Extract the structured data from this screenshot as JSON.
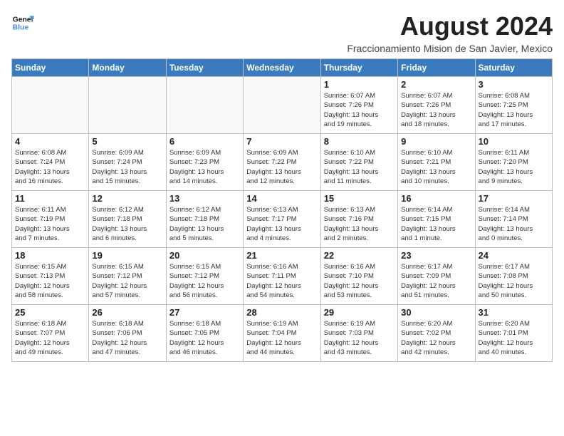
{
  "header": {
    "logo_line1": "General",
    "logo_line2": "Blue",
    "month_year": "August 2024",
    "location": "Fraccionamiento Mision de San Javier, Mexico"
  },
  "days_of_week": [
    "Sunday",
    "Monday",
    "Tuesday",
    "Wednesday",
    "Thursday",
    "Friday",
    "Saturday"
  ],
  "weeks": [
    [
      {
        "day": "",
        "info": ""
      },
      {
        "day": "",
        "info": ""
      },
      {
        "day": "",
        "info": ""
      },
      {
        "day": "",
        "info": ""
      },
      {
        "day": "1",
        "info": "Sunrise: 6:07 AM\nSunset: 7:26 PM\nDaylight: 13 hours\nand 19 minutes."
      },
      {
        "day": "2",
        "info": "Sunrise: 6:07 AM\nSunset: 7:26 PM\nDaylight: 13 hours\nand 18 minutes."
      },
      {
        "day": "3",
        "info": "Sunrise: 6:08 AM\nSunset: 7:25 PM\nDaylight: 13 hours\nand 17 minutes."
      }
    ],
    [
      {
        "day": "4",
        "info": "Sunrise: 6:08 AM\nSunset: 7:24 PM\nDaylight: 13 hours\nand 16 minutes."
      },
      {
        "day": "5",
        "info": "Sunrise: 6:09 AM\nSunset: 7:24 PM\nDaylight: 13 hours\nand 15 minutes."
      },
      {
        "day": "6",
        "info": "Sunrise: 6:09 AM\nSunset: 7:23 PM\nDaylight: 13 hours\nand 14 minutes."
      },
      {
        "day": "7",
        "info": "Sunrise: 6:09 AM\nSunset: 7:22 PM\nDaylight: 13 hours\nand 12 minutes."
      },
      {
        "day": "8",
        "info": "Sunrise: 6:10 AM\nSunset: 7:22 PM\nDaylight: 13 hours\nand 11 minutes."
      },
      {
        "day": "9",
        "info": "Sunrise: 6:10 AM\nSunset: 7:21 PM\nDaylight: 13 hours\nand 10 minutes."
      },
      {
        "day": "10",
        "info": "Sunrise: 6:11 AM\nSunset: 7:20 PM\nDaylight: 13 hours\nand 9 minutes."
      }
    ],
    [
      {
        "day": "11",
        "info": "Sunrise: 6:11 AM\nSunset: 7:19 PM\nDaylight: 13 hours\nand 7 minutes."
      },
      {
        "day": "12",
        "info": "Sunrise: 6:12 AM\nSunset: 7:18 PM\nDaylight: 13 hours\nand 6 minutes."
      },
      {
        "day": "13",
        "info": "Sunrise: 6:12 AM\nSunset: 7:18 PM\nDaylight: 13 hours\nand 5 minutes."
      },
      {
        "day": "14",
        "info": "Sunrise: 6:13 AM\nSunset: 7:17 PM\nDaylight: 13 hours\nand 4 minutes."
      },
      {
        "day": "15",
        "info": "Sunrise: 6:13 AM\nSunset: 7:16 PM\nDaylight: 13 hours\nand 2 minutes."
      },
      {
        "day": "16",
        "info": "Sunrise: 6:14 AM\nSunset: 7:15 PM\nDaylight: 13 hours\nand 1 minute."
      },
      {
        "day": "17",
        "info": "Sunrise: 6:14 AM\nSunset: 7:14 PM\nDaylight: 13 hours\nand 0 minutes."
      }
    ],
    [
      {
        "day": "18",
        "info": "Sunrise: 6:15 AM\nSunset: 7:13 PM\nDaylight: 12 hours\nand 58 minutes."
      },
      {
        "day": "19",
        "info": "Sunrise: 6:15 AM\nSunset: 7:12 PM\nDaylight: 12 hours\nand 57 minutes."
      },
      {
        "day": "20",
        "info": "Sunrise: 6:15 AM\nSunset: 7:12 PM\nDaylight: 12 hours\nand 56 minutes."
      },
      {
        "day": "21",
        "info": "Sunrise: 6:16 AM\nSunset: 7:11 PM\nDaylight: 12 hours\nand 54 minutes."
      },
      {
        "day": "22",
        "info": "Sunrise: 6:16 AM\nSunset: 7:10 PM\nDaylight: 12 hours\nand 53 minutes."
      },
      {
        "day": "23",
        "info": "Sunrise: 6:17 AM\nSunset: 7:09 PM\nDaylight: 12 hours\nand 51 minutes."
      },
      {
        "day": "24",
        "info": "Sunrise: 6:17 AM\nSunset: 7:08 PM\nDaylight: 12 hours\nand 50 minutes."
      }
    ],
    [
      {
        "day": "25",
        "info": "Sunrise: 6:18 AM\nSunset: 7:07 PM\nDaylight: 12 hours\nand 49 minutes."
      },
      {
        "day": "26",
        "info": "Sunrise: 6:18 AM\nSunset: 7:06 PM\nDaylight: 12 hours\nand 47 minutes."
      },
      {
        "day": "27",
        "info": "Sunrise: 6:18 AM\nSunset: 7:05 PM\nDaylight: 12 hours\nand 46 minutes."
      },
      {
        "day": "28",
        "info": "Sunrise: 6:19 AM\nSunset: 7:04 PM\nDaylight: 12 hours\nand 44 minutes."
      },
      {
        "day": "29",
        "info": "Sunrise: 6:19 AM\nSunset: 7:03 PM\nDaylight: 12 hours\nand 43 minutes."
      },
      {
        "day": "30",
        "info": "Sunrise: 6:20 AM\nSunset: 7:02 PM\nDaylight: 12 hours\nand 42 minutes."
      },
      {
        "day": "31",
        "info": "Sunrise: 6:20 AM\nSunset: 7:01 PM\nDaylight: 12 hours\nand 40 minutes."
      }
    ]
  ]
}
